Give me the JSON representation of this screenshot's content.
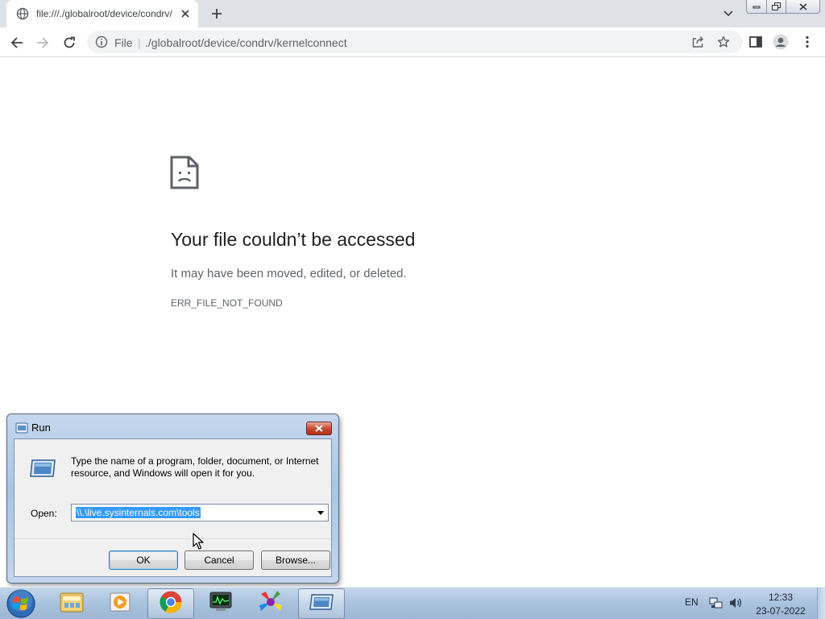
{
  "browser": {
    "tab_title": "file:///./globalroot/device/condrv/",
    "url_scheme": "File",
    "url_path": "./globalroot/device/condrv/kernelconnect"
  },
  "error_page": {
    "heading": "Your file couldn’t be accessed",
    "message": "It may have been moved, edited, or deleted.",
    "code": "ERR_FILE_NOT_FOUND"
  },
  "run_dialog": {
    "title": "Run",
    "description": "Type the name of a program, folder, document, or Internet resource, and Windows will open it for you.",
    "open_label": "Open:",
    "open_value": "\\\\.\\live.sysinternals.com\\tools",
    "ok_label": "OK",
    "cancel_label": "Cancel",
    "browse_label": "Browse..."
  },
  "taskbar": {
    "items": [
      "file-explorer",
      "media-player",
      "chrome",
      "task-manager",
      "colorful-app",
      "run"
    ],
    "language": "EN",
    "time": "12:33",
    "date": "23-07-2022"
  },
  "colors": {
    "tab_strip": "#dee1e6",
    "omnibox": "#f1f3f4",
    "selection": "#3399ff",
    "taskbar": "#a9c2dd"
  }
}
